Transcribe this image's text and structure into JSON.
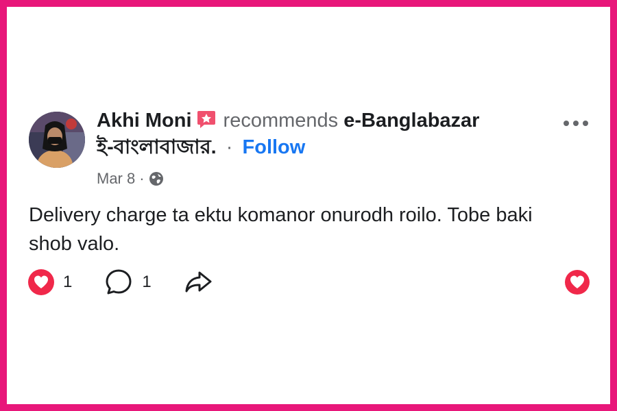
{
  "post": {
    "author": "Akhi Moni",
    "verb": "recommends",
    "page_name": "e-Banglabazar",
    "page_name_bn": "ই-বাংলাবাজার.",
    "separator": "·",
    "follow_label": "Follow",
    "date": "Mar 8",
    "meta_separator": "·",
    "privacy_icon": "globe-icon",
    "text": "Delivery charge ta ektu komanor onurodh roilo. Tobe baki shob valo."
  },
  "actions": {
    "reaction_count": "1",
    "comment_count": "1"
  },
  "colors": {
    "frame": "#e8177a",
    "link": "#1877f2",
    "secondary_text": "#65676b",
    "reaction_red": "#f0284a"
  }
}
